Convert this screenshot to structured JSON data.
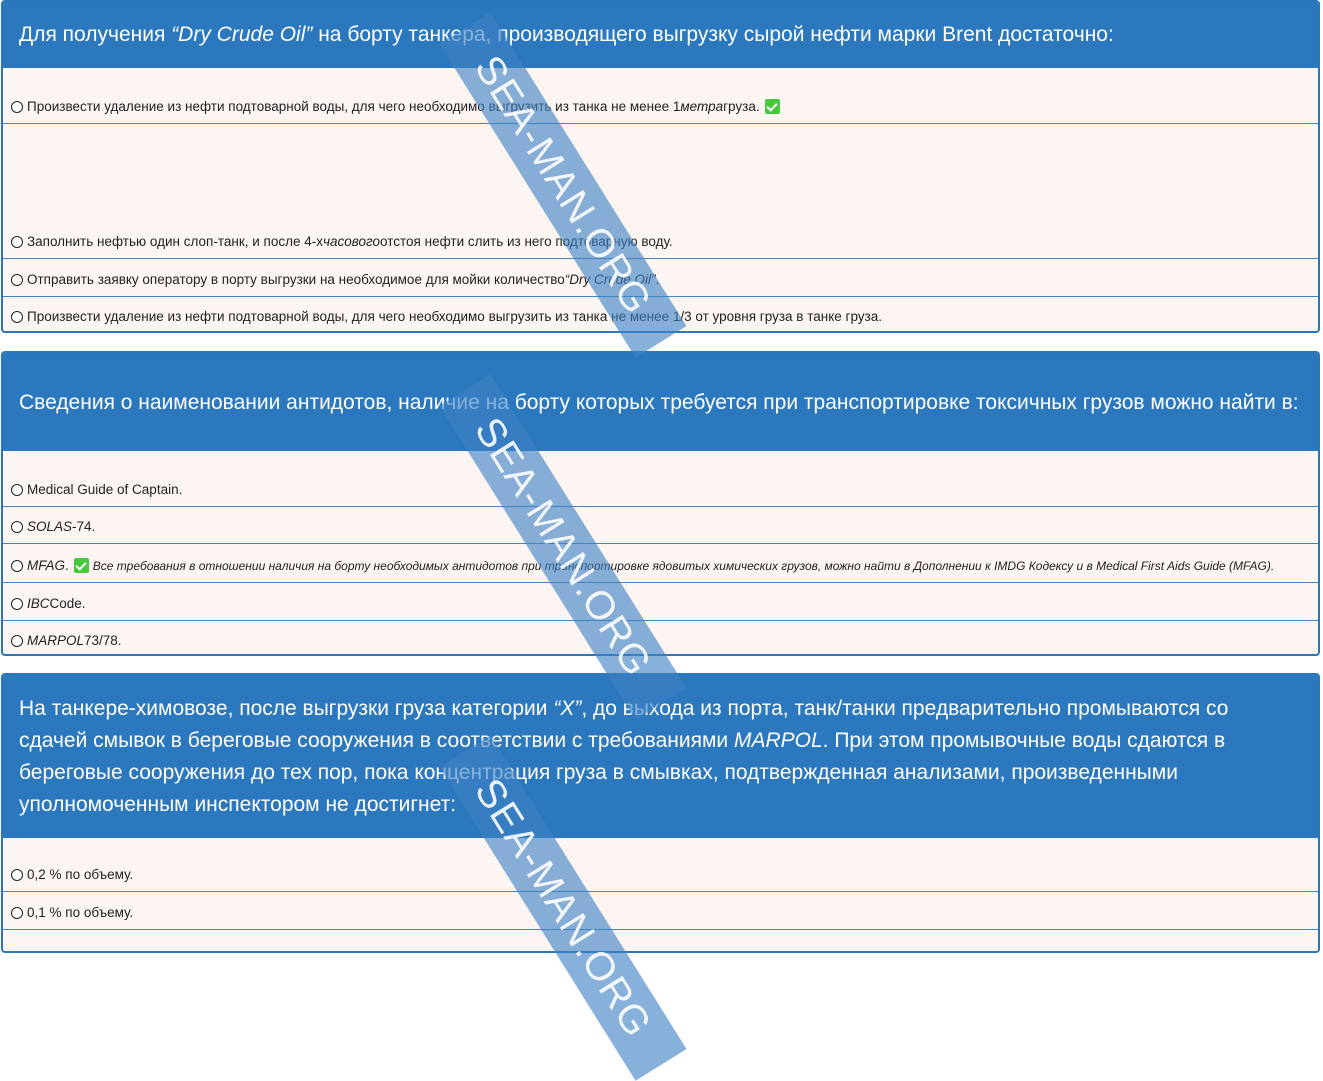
{
  "q1": {
    "pre": "Для получения ",
    "em": "“Dry Crude Oil”",
    "post": " на борту танкера, производящего выгрузку сырой нефти марки Brent достаточно:",
    "a1": {
      "pre": "Произвести удаление из нефти подтоварной воды, для чего необходимо выгрузить из танка не менее 1 ",
      "em": "метра",
      "post": " груза."
    },
    "a2": {
      "pre": "Заполнить нефтью один слоп-танк, и после 4-х ",
      "em": "часового",
      "post": " отстоя нефти слить из него подтоварную воду."
    },
    "a3": {
      "pre": "Отправить заявку оператору в порту выгрузки на необходимое для мойки количество ",
      "em": "“Dry Crude Oil”",
      "post": "."
    },
    "a4": {
      "text": "Произвести удаление из нефти подтоварной воды, для чего необходимо выгрузить из танка не менее 1/3 от уровня груза в танке груза."
    }
  },
  "q2": {
    "text": "Сведения о наименовании антидотов, наличие на борту которых требуется при транспортировке токсичных грузов можно найти в:",
    "a1": {
      "text": "Medical Guide of Captain."
    },
    "a2": {
      "em": "SOLAS",
      "post": "-74."
    },
    "a3": {
      "em": "MFAG",
      "post": ".",
      "note": "Все требования в отношении наличия на борту необходимых антидотов при транспортировке ядовитых химических грузов, можно найти в Дополнении к IMDG Кодексу и в Medical First Aids Guide (MFAG)."
    },
    "a4": {
      "em": "IBC",
      "post": " Code."
    },
    "a5": {
      "em": "MARPOL",
      "post": " 73/78."
    }
  },
  "q3": {
    "pre": "На танкере-химовозе, после выгрузки груза категории ",
    "em1": "“X”",
    "mid": ", до выхода из порта, танк/танки предварительно промываются со сдачей смывок в береговые сооружения в соответствии с требованиями ",
    "em2": "MARPOL",
    "post": ". При этом промывочные воды сдаются в береговые сооружения до тех пор, пока концентрация груза в смывках, подтвержденная анализами, произведенными уполномоченным инспектором не достигнет:",
    "a1": {
      "text": "0,2 % по объему."
    },
    "a2": {
      "text": "0,1 % по объему."
    }
  },
  "watermark": "SEA-MAN.ORG",
  "colors": {
    "header": "#2b78be",
    "card_bg": "#fdf5f2",
    "border": "#2a77bd",
    "check": "#48c93c",
    "watermark": "#3e81c4"
  }
}
